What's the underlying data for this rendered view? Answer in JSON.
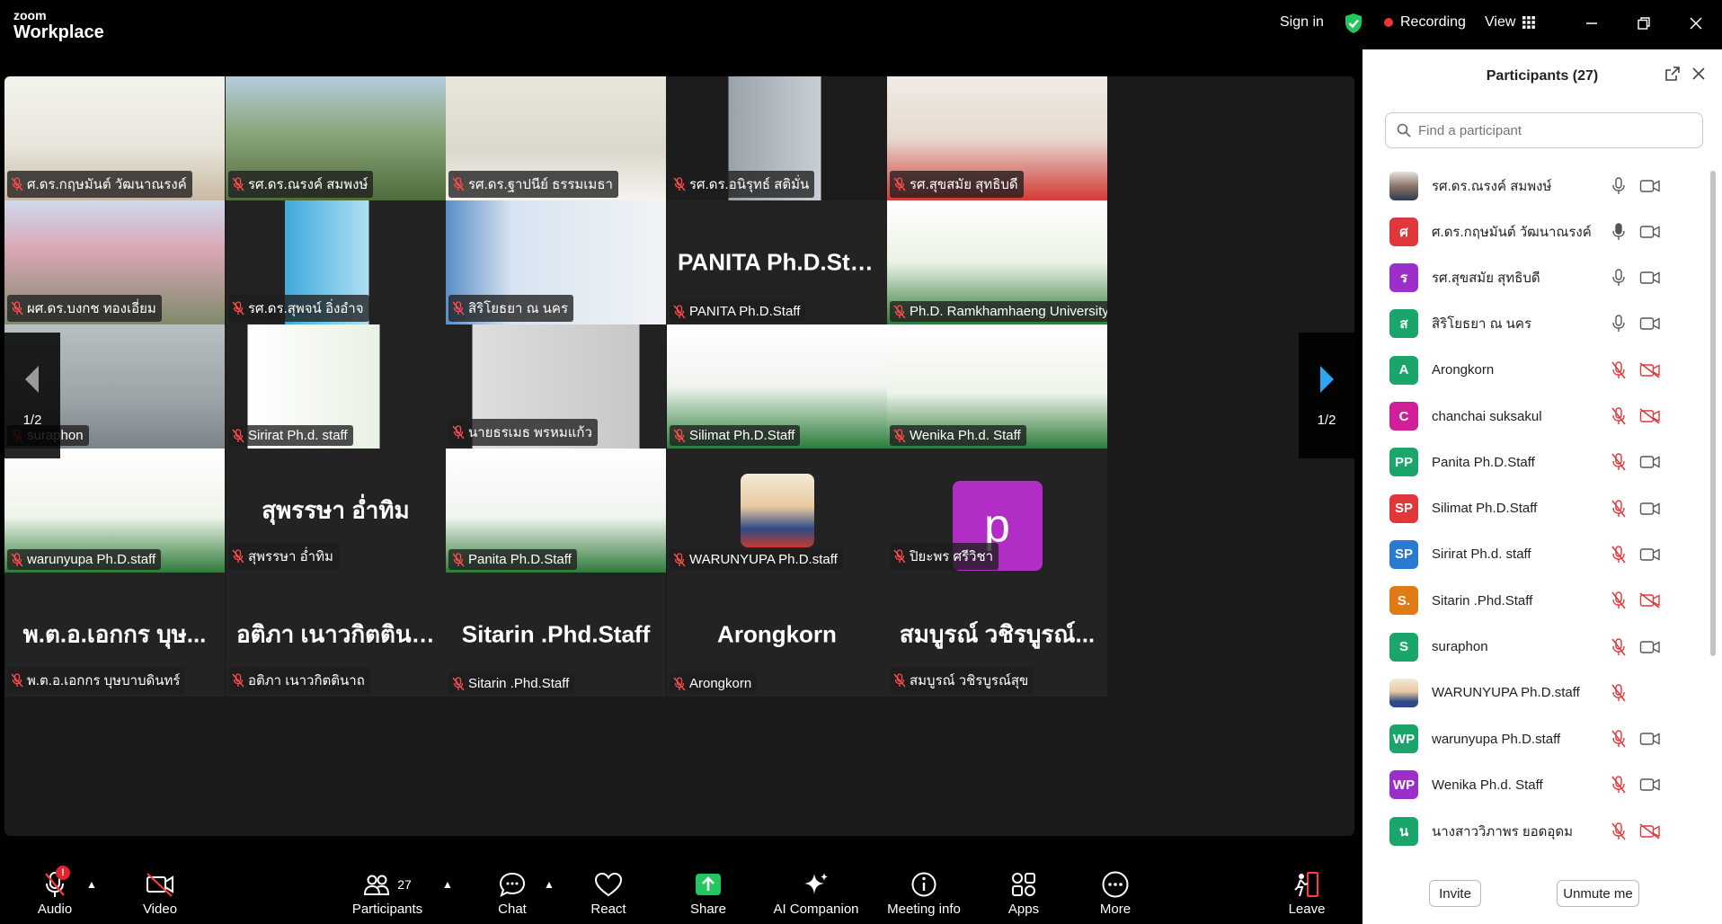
{
  "titlebar": {
    "brand_small": "zoom",
    "brand_big": "Workplace",
    "sign_in": "Sign in",
    "recording": "Recording",
    "view": "View",
    "colors": {
      "background": "#000000",
      "shield": "#22c55e",
      "record_dot": "#f0333a"
    }
  },
  "gallery": {
    "page_indicator": "1/2",
    "tiles": [
      {
        "name": "ศ.ดร.กฤษมันต์ วัฒนาณรงค์",
        "video": true,
        "speaking": true,
        "bg": "linear-gradient(180deg,#f3f3ee 0%,#e9e6dc 55%,#c9b9a2 100%)"
      },
      {
        "name": "รศ.ดร.ณรงค์ สมพงษ์",
        "video": true,
        "bg": "linear-gradient(180deg,#b7cde0 0%,#8aa57a 45%,#4f6d3c 100%)"
      },
      {
        "name": "รศ.ดร.ฐาปนีย์ ธรรมเมธา",
        "video": true,
        "bg": "linear-gradient(180deg,#e9e6dc 0%,#ddd8cc 60%,#f5f3ee 100%)"
      },
      {
        "name": "รศ.ดร.อนิรุทธ์ สติมั่น",
        "video": true,
        "bg": "linear-gradient(90deg,#1c1c1c 0%,#1c1c1c 28%,#9aa3ab 28%,#c8ced3 70%,#1c1c1c 70%)"
      },
      {
        "name": "รศ.สุขสมัย สุทธิบดี",
        "video": true,
        "bg": "linear-gradient(180deg,#f0ece6 0%,#e6d9cf 50%,#d23a35 100%)"
      },
      {
        "name": "ผศ.ดร.บงกช ทองเอี่ยม",
        "video": true,
        "bg": "linear-gradient(180deg,#cfd9ea 0%,#d9a6b5 40%,#7f8a6a 100%)"
      },
      {
        "name": "รศ.ดร.สุพจน์ อิ่งอำจ",
        "video": true,
        "bg": "linear-gradient(90deg,#222 0%,#222 27%,#3fa9dc 27%,#aee0f3 65%,#222 65%)"
      },
      {
        "name": "สิริโยธยา ณ นคร",
        "video": true,
        "bg": "linear-gradient(90deg,#5b8ec9 0%,#d7e4f1 30%,#f1f3f6 100%)"
      },
      {
        "name": "PANITA Ph.D.Staff",
        "video": false,
        "bigname": "PANITA Ph.D.Staff",
        "bg": "#232323"
      },
      {
        "name": "Ph.D. Ramkhamhaeng University",
        "video": true,
        "bg": "linear-gradient(180deg,#ffffff 0%,#eaf3e4 50%,#2f7a3a 100%)"
      },
      {
        "name": "suraphon",
        "video": true,
        "bg": "linear-gradient(180deg,#b8bfc3 0%,#9ca4a8 60%,#7b8489 100%)"
      },
      {
        "name": "Sirirat Ph.d. staff",
        "video": true,
        "bg": "linear-gradient(90deg,#222 0%,#222 10%,#ffffff 10%,#e8f2e3 70%,#222 70%)"
      },
      {
        "name": "นายธรเมธ พรหมแก้ว",
        "video": true,
        "bg": "linear-gradient(90deg,#222 0%,#222 12%,#dedede 12%,#c7c7c7 88%,#222 88%)"
      },
      {
        "name": "Silimat Ph.D.Staff",
        "video": true,
        "bg": "linear-gradient(180deg,#ffffff 0%,#f0f4ee 50%,#2b7d3a 100%)"
      },
      {
        "name": "Wenika Ph.d. Staff",
        "video": true,
        "bg": "linear-gradient(180deg,#ffffff 0%,#eef4ea 55%,#2f7a3a 100%)"
      },
      {
        "name": "warunyupa Ph.D.staff",
        "video": true,
        "bg": "linear-gradient(180deg,#ffffff 0%,#eef4ea 55%,#2f7a3a 100%)"
      },
      {
        "name": "สุพรรษา อ่ำทิม",
        "video": false,
        "bigname": "สุพรรษา อ่ำทิม",
        "bg": "#232323"
      },
      {
        "name": "Panita Ph.D.Staff",
        "video": true,
        "bg": "linear-gradient(180deg,#ffffff 0%,#f1f5ef 55%,#2f7a3a 100%)"
      },
      {
        "name": "WARUNYUPA Ph.D.staff",
        "video": false,
        "avatar": "photo",
        "bg": "#232323"
      },
      {
        "name": "ปิยะพร ศรีวิชา",
        "video": false,
        "avatar": "p",
        "bg": "#232323"
      },
      {
        "name": "พ.ต.อ.เอกกร บุษบาบดินทร์",
        "video": false,
        "bigname": "พ.ต.อ.เอกกร บุษ...",
        "bg": "#232323"
      },
      {
        "name": "อติภา เนาวกิตตินาถ",
        "video": false,
        "bigname": "อติภา เนาวกิตตินาถ",
        "bg": "#232323"
      },
      {
        "name": "Sitarin .Phd.Staff",
        "video": false,
        "bigname": "Sitarin .Phd.Staff",
        "bg": "#232323"
      },
      {
        "name": "Arongkorn",
        "video": false,
        "bigname": "Arongkorn",
        "bg": "#232323"
      },
      {
        "name": "สมบูรณ์ วชิรบูรณ์สุข",
        "video": false,
        "bigname": "สมบูรณ์ วชิรบูรณ์...",
        "bg": "#232323"
      }
    ]
  },
  "controls": {
    "audio": "Audio",
    "video": "Video",
    "participants": "Participants",
    "participants_count": "27",
    "chat": "Chat",
    "react": "React",
    "share": "Share",
    "ai_companion": "AI Companion",
    "meeting_info": "Meeting info",
    "apps": "Apps",
    "more": "More",
    "leave": "Leave",
    "audio_badge": "!"
  },
  "panel": {
    "title": "Participants (27)",
    "search_placeholder": "Find a participant",
    "invite": "Invite",
    "unmute_me": "Unmute me",
    "participants": [
      {
        "name": "รศ.ดร.ณรงค์ สมพงษ์",
        "initial": "",
        "color": "#7a6a60",
        "mic": "on",
        "cam": "on",
        "photo": true
      },
      {
        "name": "ศ.ดร.กฤษมันต์ วัฒนาณรงค์",
        "initial": "ศ",
        "color": "#e0373a",
        "mic": "active",
        "cam": "on"
      },
      {
        "name": "รศ.สุขสมัย สุทธิบดี",
        "initial": "ร",
        "color": "#9c2fc9",
        "mic": "on",
        "cam": "on"
      },
      {
        "name": "สิริโยธยา ณ นคร",
        "initial": "ส",
        "color": "#1aa56a",
        "mic": "on",
        "cam": "on"
      },
      {
        "name": "Arongkorn",
        "initial": "A",
        "color": "#1aa56a",
        "mic": "off",
        "cam": "off"
      },
      {
        "name": "chanchai suksakul",
        "initial": "C",
        "color": "#d11f9a",
        "mic": "off",
        "cam": "off"
      },
      {
        "name": "Panita Ph.D.Staff",
        "initial": "PP",
        "color": "#1aa56a",
        "mic": "off",
        "cam": "on"
      },
      {
        "name": "Silimat Ph.D.Staff",
        "initial": "SP",
        "color": "#e0373a",
        "mic": "off",
        "cam": "on"
      },
      {
        "name": "Sirirat Ph.d. staff",
        "initial": "SP",
        "color": "#2a7ad1",
        "mic": "off",
        "cam": "on"
      },
      {
        "name": "Sitarin .Phd.Staff",
        "initial": "S.",
        "color": "#e07a12",
        "mic": "off",
        "cam": "off"
      },
      {
        "name": "suraphon",
        "initial": "S",
        "color": "#1aa56a",
        "mic": "off",
        "cam": "on"
      },
      {
        "name": "WARUNYUPA Ph.D.staff",
        "initial": "",
        "color": "#c9a27a",
        "mic": "off",
        "cam": "none",
        "photo": true
      },
      {
        "name": "warunyupa Ph.D.staff",
        "initial": "WP",
        "color": "#1aa56a",
        "mic": "off",
        "cam": "on"
      },
      {
        "name": "Wenika Ph.d. Staff",
        "initial": "WP",
        "color": "#9c2fc9",
        "mic": "off",
        "cam": "on"
      },
      {
        "name": "นางสาววิภาพร ยอดอุดม",
        "initial": "น",
        "color": "#1aa56a",
        "mic": "off",
        "cam": "off"
      }
    ]
  }
}
